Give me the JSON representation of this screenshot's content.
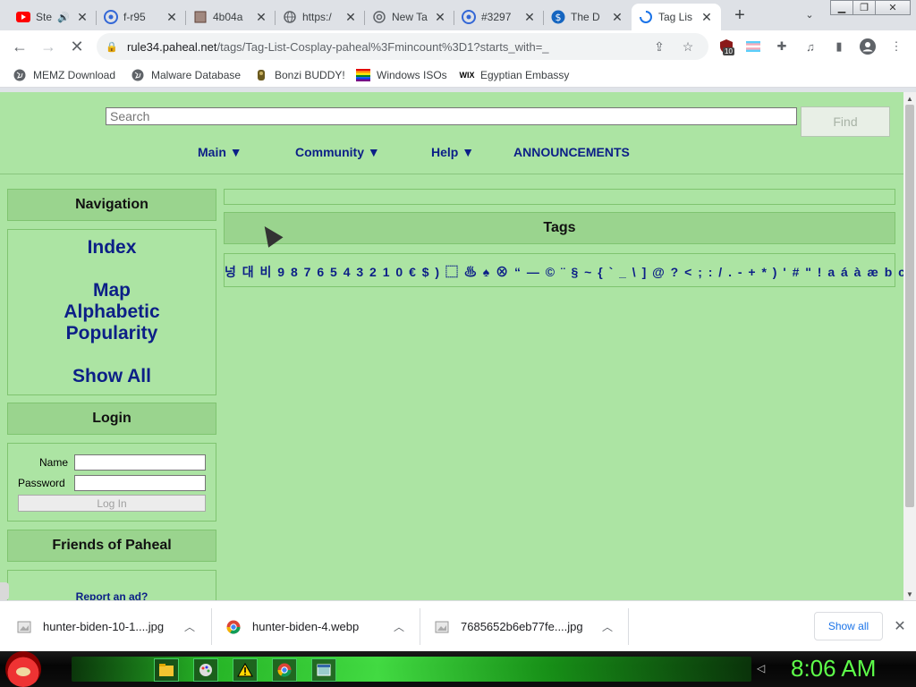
{
  "browser": {
    "tabs": [
      {
        "title": "Ste",
        "icon": "youtube-icon",
        "color": "#ff0000"
      },
      {
        "title": "f-r95",
        "icon": "e-icon",
        "color": "#3367d6"
      },
      {
        "title": "4b04a",
        "icon": "cube-icon",
        "color": "#8d6e63"
      },
      {
        "title": "https:/",
        "icon": "globe-icon",
        "color": "#5f6368"
      },
      {
        "title": "New Ta",
        "icon": "chrome-icon",
        "color": "#5f6368"
      },
      {
        "title": "#3297",
        "icon": "e-icon",
        "color": "#3367d6"
      },
      {
        "title": "The D",
        "icon": "dollar-icon",
        "color": "#1565c0"
      },
      {
        "title": "Tag Lis",
        "icon": "loading-icon",
        "color": "#1a73e8"
      }
    ],
    "url_domain": "rule34.paheal.net",
    "url_path": "/tags/Tag-List-Cosplay-paheal%3Fmincount%3D1?starts_with=_",
    "extension_badge": "10",
    "bookmarks": [
      {
        "label": "MEMZ Download"
      },
      {
        "label": "Malware Database"
      },
      {
        "label": "Bonzi BUDDY!"
      },
      {
        "label": "Windows ISOs"
      },
      {
        "label": "Egyptian Embassy"
      }
    ]
  },
  "site": {
    "search_placeholder": "Search",
    "find_label": "Find",
    "menu": {
      "main": "Main ▼",
      "community": "Community ▼",
      "help": "Help ▼",
      "announcements": "ANNOUNCEMENTS"
    },
    "navigation": {
      "title": "Navigation",
      "index": "Index",
      "map": "Map",
      "alphabetic": "Alphabetic",
      "popularity": "Popularity",
      "show_all": "Show All"
    },
    "login": {
      "title": "Login",
      "name_label": "Name",
      "password_label": "Password",
      "button": "Log In"
    },
    "friends": {
      "title": "Friends of Paheal",
      "report_ad": "Report an ad?"
    },
    "tags": {
      "title": "Tags",
      "chars": "넝 대 비  9 8 7 6 5 4 3 2 1 0 € $ )    ⬚ ♨ ♠ ⊗ “ — © ¨ §  ~ { ` _ \\ ] @ ? < ; : / . - + * ) ' # \" !  a á à æ b c č d"
    }
  },
  "downloads": {
    "items": [
      {
        "name": "hunter-biden-10-1....jpg"
      },
      {
        "name": "hunter-biden-4.webp"
      },
      {
        "name": "7685652b6eb77fe....jpg"
      }
    ],
    "show_all": "Show all"
  },
  "taskbar": {
    "clock": "8:06 AM"
  }
}
